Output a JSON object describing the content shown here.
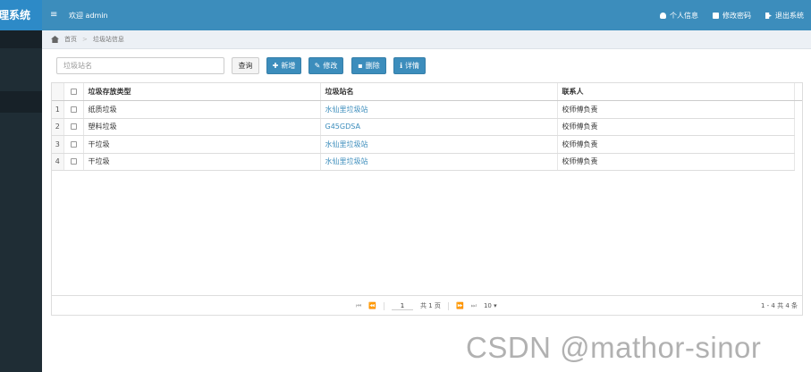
{
  "brand": "理系统",
  "header": {
    "welcome": "欢迎 admin",
    "nav": [
      "个人信息",
      "修改密码",
      "退出系统"
    ]
  },
  "breadcrumb": [
    "首页",
    "垃圾站信息"
  ],
  "toolbar": {
    "search_placeholder": "垃圾站名",
    "query": "查询",
    "add": "新增",
    "edit": "修改",
    "delete": "删除",
    "detail": "详情"
  },
  "table": {
    "columns": [
      "垃圾存放类型",
      "垃圾站名",
      "联系人"
    ],
    "rows": [
      {
        "num": "1",
        "type": "纸质垃圾",
        "station": "水仙里垃圾站",
        "contact": "校师傅负责"
      },
      {
        "num": "2",
        "type": "塑料垃圾",
        "station": "G45GDSA",
        "contact": "校师傅负责"
      },
      {
        "num": "3",
        "type": "干垃圾",
        "station": "水仙里垃圾站",
        "contact": "校师傅负责"
      },
      {
        "num": "4",
        "type": "干垃圾",
        "station": "水仙里垃圾站",
        "contact": "校师傅负责"
      }
    ]
  },
  "pager": {
    "first": "⏮",
    "prev": "⏪",
    "page": "1",
    "total_pages": "共 1 页",
    "next": "⏩",
    "last": "⏭",
    "page_size": "10 ▾",
    "summary": "1 - 4  共 4 条"
  },
  "watermark": "CSDN @mathor-sinor"
}
